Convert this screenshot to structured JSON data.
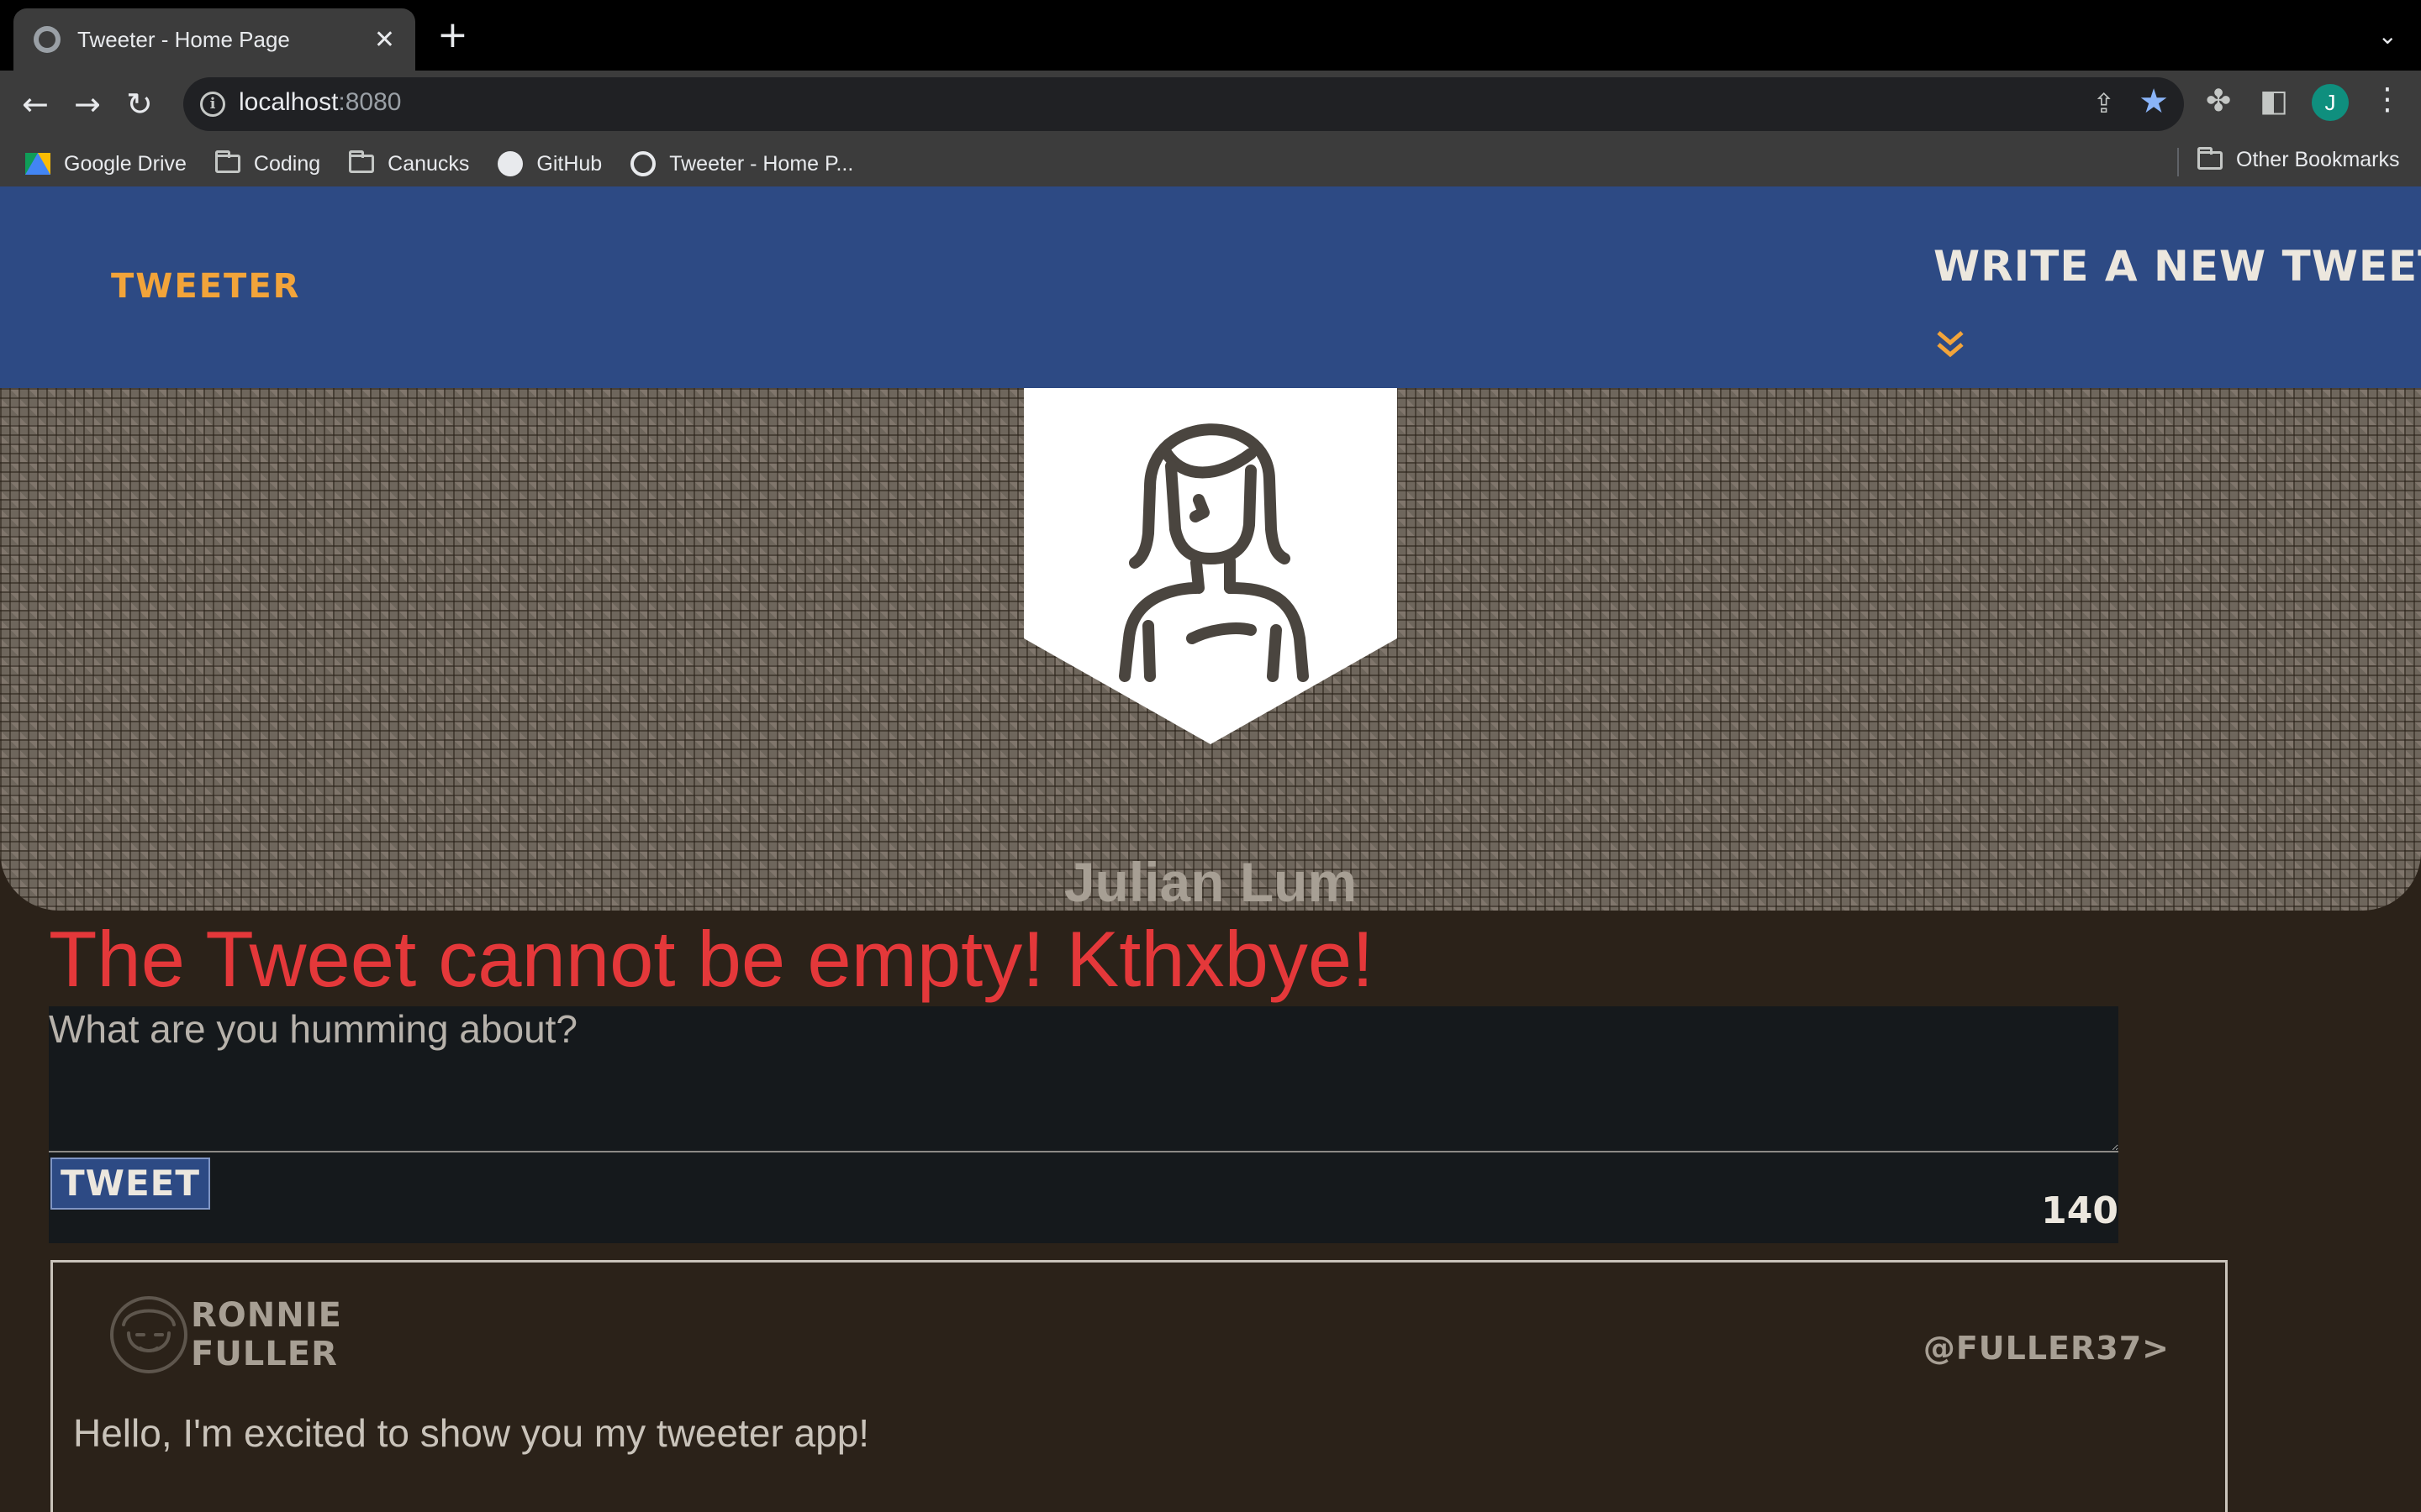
{
  "browser": {
    "tab_title": "Tweeter - Home Page",
    "tab_close": "✕",
    "new_tab": "+",
    "tab_menu": "⌄",
    "url_host": "localhost",
    "url_port": ":8080",
    "avatar_letter": "J",
    "bookmarks": [
      {
        "label": "Google Drive",
        "icon": "google-drive-icon"
      },
      {
        "label": "Coding",
        "icon": "folder-icon"
      },
      {
        "label": "Canucks",
        "icon": "folder-icon"
      },
      {
        "label": "GitHub",
        "icon": "github-icon"
      },
      {
        "label": "Tweeter - Home P...",
        "icon": "globe-icon"
      }
    ],
    "other_bookmarks": "Other Bookmarks"
  },
  "nav": {
    "brand": "Tweeter",
    "compose_label": "Write a new tweet",
    "compose_icon": "double-chevron-down-icon",
    "accent_color": "#f2a43a",
    "background_color": "#2d4a84"
  },
  "profile": {
    "name": "Julian Lum",
    "avatar_icon": "person-avatar-icon"
  },
  "composer": {
    "error": "The Tweet cannot be empty! Kthxbye!",
    "error_color": "#e4383a",
    "placeholder": "What are you humming about?",
    "value": "",
    "button_label": "Tweet",
    "counter": "140"
  },
  "tweets": [
    {
      "name": "Ronnie Fuller",
      "handle": "@fuller37>",
      "content": "Hello, I'm excited to show you my tweeter app!"
    }
  ]
}
